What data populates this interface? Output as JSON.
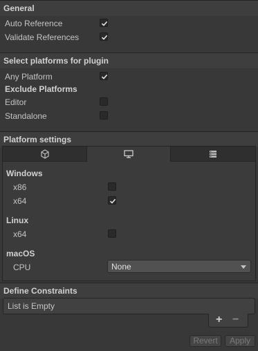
{
  "general": {
    "title": "General",
    "auto_reference": {
      "label": "Auto Reference",
      "checked": true
    },
    "validate_references": {
      "label": "Validate References",
      "checked": true
    }
  },
  "platforms": {
    "title": "Select platforms for plugin",
    "any_platform": {
      "label": "Any Platform",
      "checked": true
    },
    "exclude_title": "Exclude Platforms",
    "editor": {
      "label": "Editor",
      "checked": false
    },
    "standalone": {
      "label": "Standalone",
      "checked": false
    }
  },
  "platform_settings": {
    "title": "Platform settings",
    "tabs": [
      {
        "icon": "unity-icon",
        "active": false
      },
      {
        "icon": "monitor-icon",
        "active": true
      },
      {
        "icon": "server-icon",
        "active": false
      }
    ],
    "windows": {
      "title": "Windows",
      "x86": {
        "label": "x86",
        "checked": false
      },
      "x64": {
        "label": "x64",
        "checked": true
      }
    },
    "linux": {
      "title": "Linux",
      "x64": {
        "label": "x64",
        "checked": false
      }
    },
    "macos": {
      "title": "macOS",
      "cpu_label": "CPU",
      "cpu_value": "None"
    }
  },
  "define_constraints": {
    "title": "Define Constraints",
    "empty_text": "List is Empty",
    "add_symbol": "+",
    "remove_symbol": "−"
  },
  "footer": {
    "revert_label": "Revert",
    "apply_label": "Apply"
  }
}
